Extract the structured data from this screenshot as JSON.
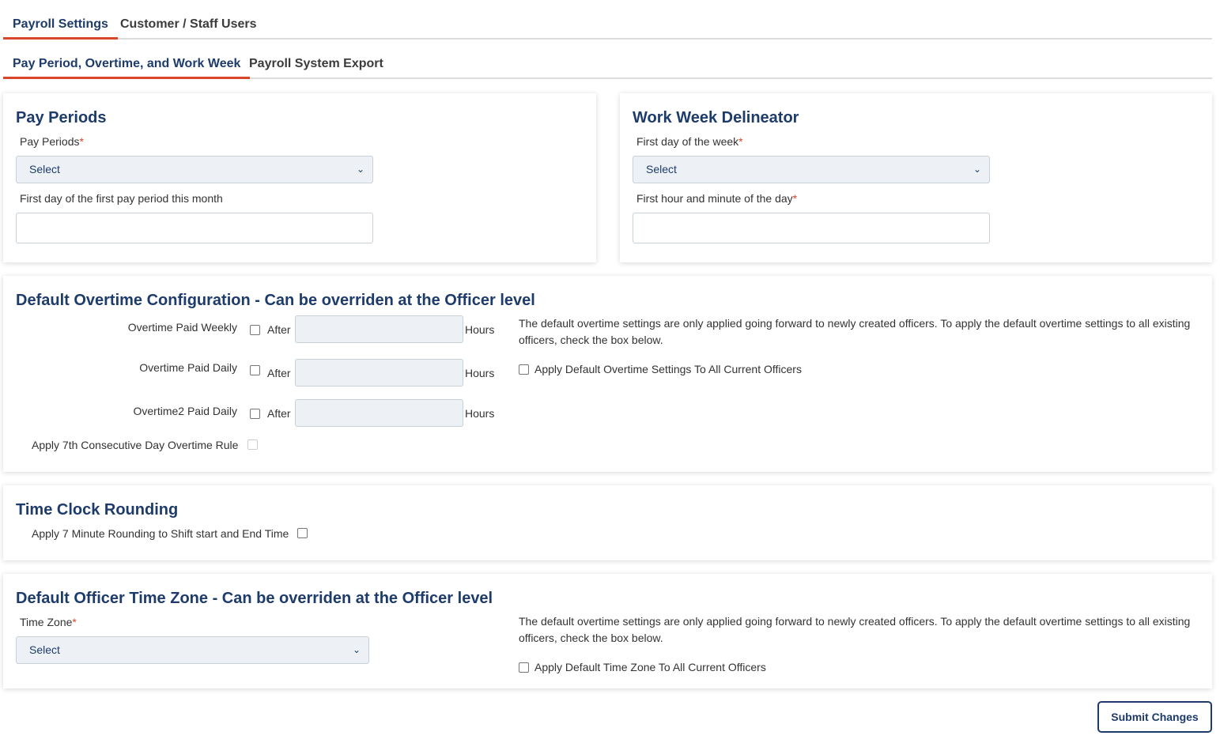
{
  "tabs": {
    "primary": [
      {
        "label": "Payroll Settings",
        "active": true
      },
      {
        "label": "Customer / Staff Users",
        "active": false
      }
    ],
    "secondary": [
      {
        "label": "Pay Period, Overtime, and Work Week",
        "active": true
      },
      {
        "label": "Payroll System Export",
        "active": false
      }
    ]
  },
  "pay_periods": {
    "title": "Pay Periods",
    "select_label": "Pay Periods",
    "select_value": "Select",
    "first_day_label": "First day of the first pay period this month",
    "first_day_value": ""
  },
  "work_week": {
    "title": "Work Week Delineator",
    "first_day_label": "First day of the week",
    "first_day_value": "Select",
    "first_hour_label": "First hour and minute of the day",
    "first_hour_value": ""
  },
  "overtime": {
    "title": "Default Overtime Configuration - Can be overriden at the Officer level",
    "rows": [
      {
        "label": "Overtime Paid Weekly",
        "after": "After",
        "hours": "Hours",
        "value": ""
      },
      {
        "label": "Overtime Paid Daily",
        "after": "After",
        "hours": "Hours",
        "value": ""
      },
      {
        "label": "Overtime2 Paid Daily",
        "after": "After",
        "hours": "Hours",
        "value": ""
      }
    ],
    "seventh_day_label": "Apply 7th Consecutive Day Overtime Rule",
    "note": "The default overtime settings are only applied going forward to newly created officers. To apply the default overtime settings to all existing officers, check the box below.",
    "apply_all_label": "Apply Default Overtime Settings To All Current Officers"
  },
  "time_clock": {
    "title": "Time Clock Rounding",
    "rounding_label": "Apply 7 Minute Rounding to Shift start and End Time"
  },
  "time_zone": {
    "title": "Default Officer Time Zone - Can be overriden at the Officer level",
    "label": "Time Zone",
    "value": "Select",
    "note": "The default overtime settings are only applied going forward to newly created officers. To apply the default overtime settings to all existing officers, check the box below.",
    "apply_all_label": "Apply Default Time Zone To All Current Officers"
  },
  "required_marker": "*",
  "submit_label": "Submit Changes",
  "colors": {
    "accent": "#d9462c",
    "navy": "#1d3b6b",
    "select_bg": "#edf1f5"
  },
  "icons": {
    "select_chevron": "chevron-down-icon"
  }
}
